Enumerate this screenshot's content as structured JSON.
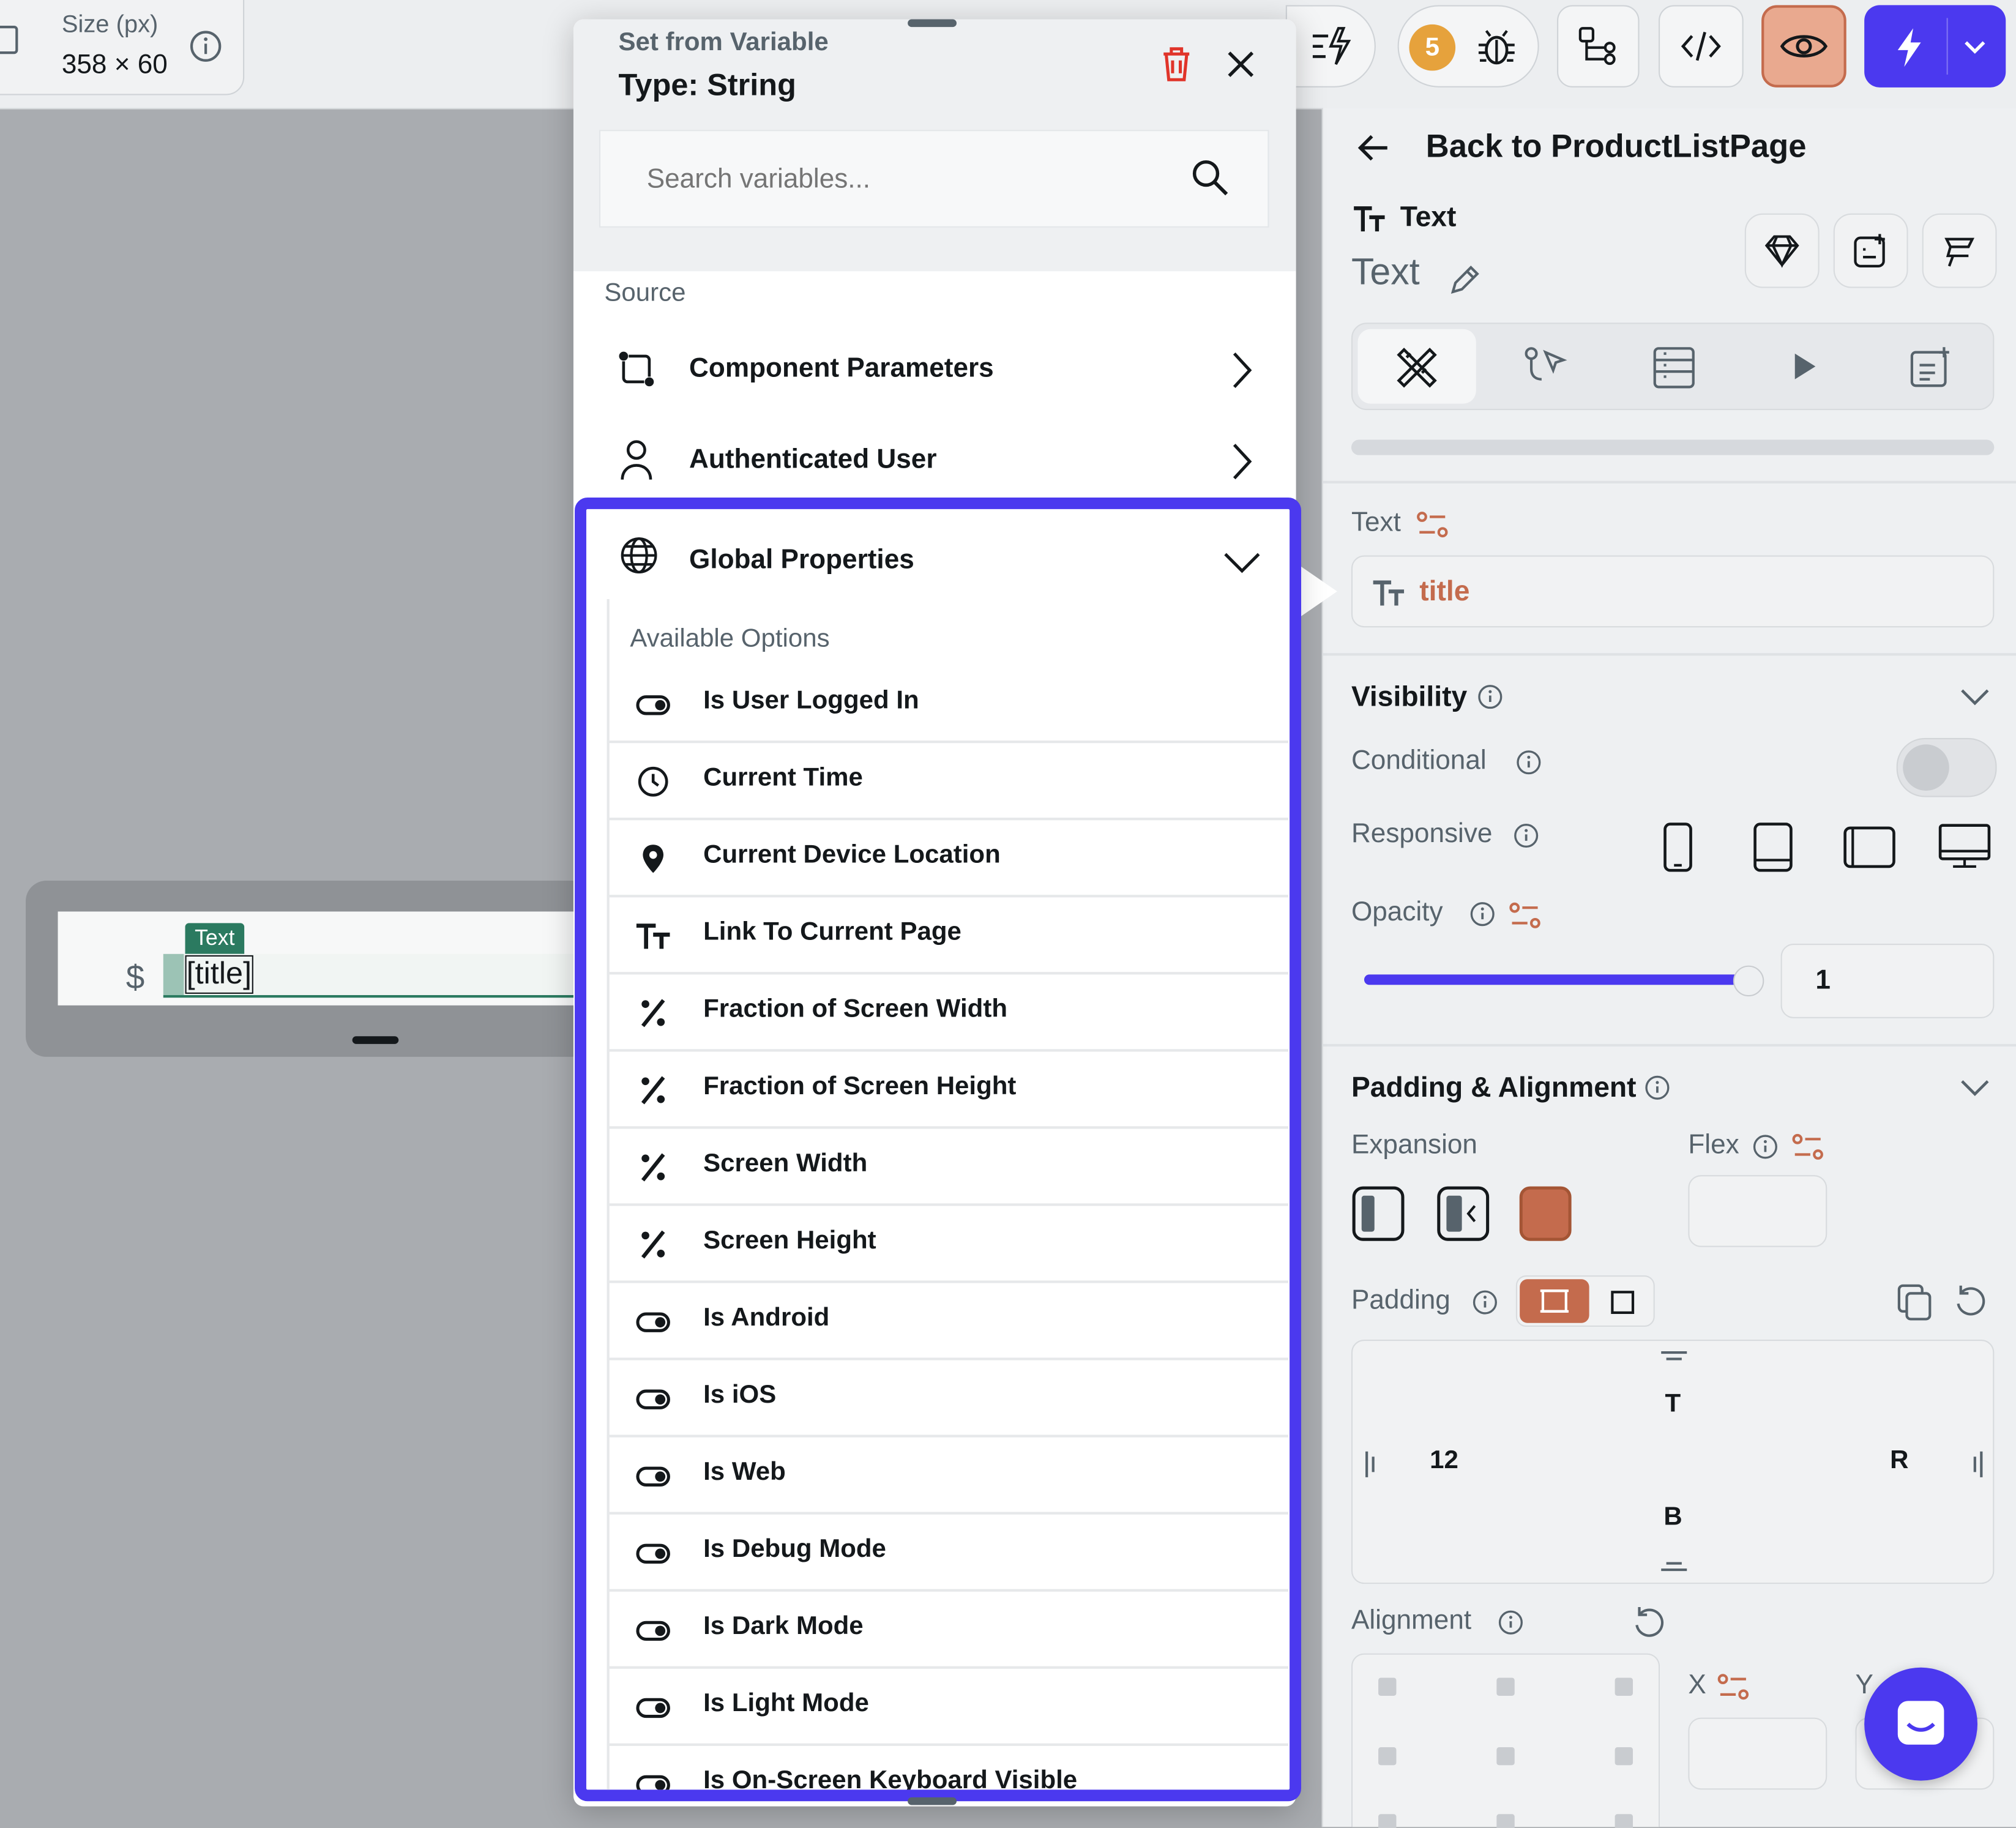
{
  "toolbar": {
    "size_label": "Size (px)",
    "size_value": "358 × 60",
    "bug_count": "5",
    "colors": {
      "accent": "#4b39ef",
      "orange": "#c46b4d",
      "preview_bg": "#e9a98f"
    }
  },
  "canvas": {
    "currency_symbol": "$",
    "text_tag": "Text",
    "text_value": "[title]"
  },
  "popover": {
    "title": "Set from Variable",
    "type_label": "Type: String",
    "search_placeholder": "Search variables...",
    "source_header": "Source",
    "sources": [
      {
        "label": "Component Parameters",
        "icon": "component-parameters-icon"
      },
      {
        "label": "Authenticated User",
        "icon": "user-icon"
      }
    ],
    "global": {
      "label": "Global Properties",
      "available_header": "Available Options",
      "options": [
        {
          "label": "Is User Logged In",
          "icon": "toggle-icon"
        },
        {
          "label": "Current Time",
          "icon": "clock-icon"
        },
        {
          "label": "Current Device Location",
          "icon": "location-pin-icon"
        },
        {
          "label": "Link To Current Page",
          "icon": "text-format-icon"
        },
        {
          "label": "Fraction of Screen Width",
          "icon": "percent-icon"
        },
        {
          "label": "Fraction of Screen Height",
          "icon": "percent-icon"
        },
        {
          "label": "Screen Width",
          "icon": "percent-icon"
        },
        {
          "label": "Screen Height",
          "icon": "percent-icon"
        },
        {
          "label": "Is Android",
          "icon": "toggle-icon"
        },
        {
          "label": "Is iOS",
          "icon": "toggle-icon"
        },
        {
          "label": "Is Web",
          "icon": "toggle-icon"
        },
        {
          "label": "Is Debug Mode",
          "icon": "toggle-icon"
        },
        {
          "label": "Is Dark Mode",
          "icon": "toggle-icon"
        },
        {
          "label": "Is Light Mode",
          "icon": "toggle-icon"
        },
        {
          "label": "Is On-Screen Keyboard Visible",
          "icon": "toggle-icon"
        }
      ]
    }
  },
  "panel": {
    "back_label": "Back to ProductListPage",
    "widget_type": "Text",
    "widget_name": "Text",
    "text_section": {
      "label": "Text",
      "value": "title"
    },
    "visibility": {
      "title": "Visibility",
      "conditional_label": "Conditional",
      "responsive_label": "Responsive",
      "opacity_label": "Opacity",
      "opacity_value": "1",
      "opacity_fraction": 1
    },
    "padding_alignment": {
      "title": "Padding & Alignment",
      "expansion_label": "Expansion",
      "flex_label": "Flex",
      "padding_label": "Padding",
      "pad_top": "T",
      "pad_left": "12",
      "pad_right": "R",
      "pad_bottom": "B",
      "alignment_label": "Alignment",
      "x_label": "X",
      "y_label": "Y"
    }
  }
}
